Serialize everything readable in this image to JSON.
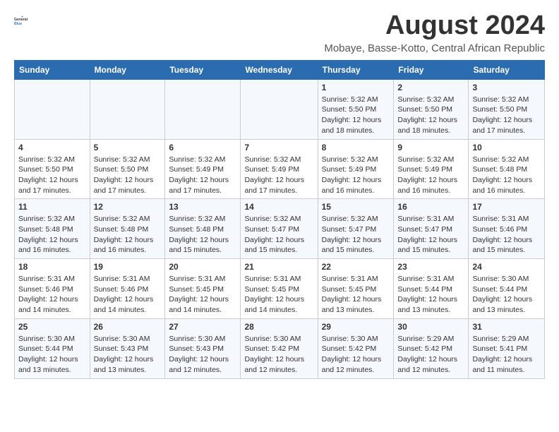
{
  "logo": {
    "line1": "General",
    "line2": "Blue"
  },
  "title": "August 2024",
  "subtitle": "Mobaye, Basse-Kotto, Central African Republic",
  "header": {
    "days": [
      "Sunday",
      "Monday",
      "Tuesday",
      "Wednesday",
      "Thursday",
      "Friday",
      "Saturday"
    ]
  },
  "weeks": [
    [
      {
        "day": "",
        "info": ""
      },
      {
        "day": "",
        "info": ""
      },
      {
        "day": "",
        "info": ""
      },
      {
        "day": "",
        "info": ""
      },
      {
        "day": "1",
        "info": "Sunrise: 5:32 AM\nSunset: 5:50 PM\nDaylight: 12 hours\nand 18 minutes."
      },
      {
        "day": "2",
        "info": "Sunrise: 5:32 AM\nSunset: 5:50 PM\nDaylight: 12 hours\nand 18 minutes."
      },
      {
        "day": "3",
        "info": "Sunrise: 5:32 AM\nSunset: 5:50 PM\nDaylight: 12 hours\nand 17 minutes."
      }
    ],
    [
      {
        "day": "4",
        "info": "Sunrise: 5:32 AM\nSunset: 5:50 PM\nDaylight: 12 hours\nand 17 minutes."
      },
      {
        "day": "5",
        "info": "Sunrise: 5:32 AM\nSunset: 5:50 PM\nDaylight: 12 hours\nand 17 minutes."
      },
      {
        "day": "6",
        "info": "Sunrise: 5:32 AM\nSunset: 5:49 PM\nDaylight: 12 hours\nand 17 minutes."
      },
      {
        "day": "7",
        "info": "Sunrise: 5:32 AM\nSunset: 5:49 PM\nDaylight: 12 hours\nand 17 minutes."
      },
      {
        "day": "8",
        "info": "Sunrise: 5:32 AM\nSunset: 5:49 PM\nDaylight: 12 hours\nand 16 minutes."
      },
      {
        "day": "9",
        "info": "Sunrise: 5:32 AM\nSunset: 5:49 PM\nDaylight: 12 hours\nand 16 minutes."
      },
      {
        "day": "10",
        "info": "Sunrise: 5:32 AM\nSunset: 5:48 PM\nDaylight: 12 hours\nand 16 minutes."
      }
    ],
    [
      {
        "day": "11",
        "info": "Sunrise: 5:32 AM\nSunset: 5:48 PM\nDaylight: 12 hours\nand 16 minutes."
      },
      {
        "day": "12",
        "info": "Sunrise: 5:32 AM\nSunset: 5:48 PM\nDaylight: 12 hours\nand 16 minutes."
      },
      {
        "day": "13",
        "info": "Sunrise: 5:32 AM\nSunset: 5:48 PM\nDaylight: 12 hours\nand 15 minutes."
      },
      {
        "day": "14",
        "info": "Sunrise: 5:32 AM\nSunset: 5:47 PM\nDaylight: 12 hours\nand 15 minutes."
      },
      {
        "day": "15",
        "info": "Sunrise: 5:32 AM\nSunset: 5:47 PM\nDaylight: 12 hours\nand 15 minutes."
      },
      {
        "day": "16",
        "info": "Sunrise: 5:31 AM\nSunset: 5:47 PM\nDaylight: 12 hours\nand 15 minutes."
      },
      {
        "day": "17",
        "info": "Sunrise: 5:31 AM\nSunset: 5:46 PM\nDaylight: 12 hours\nand 15 minutes."
      }
    ],
    [
      {
        "day": "18",
        "info": "Sunrise: 5:31 AM\nSunset: 5:46 PM\nDaylight: 12 hours\nand 14 minutes."
      },
      {
        "day": "19",
        "info": "Sunrise: 5:31 AM\nSunset: 5:46 PM\nDaylight: 12 hours\nand 14 minutes."
      },
      {
        "day": "20",
        "info": "Sunrise: 5:31 AM\nSunset: 5:45 PM\nDaylight: 12 hours\nand 14 minutes."
      },
      {
        "day": "21",
        "info": "Sunrise: 5:31 AM\nSunset: 5:45 PM\nDaylight: 12 hours\nand 14 minutes."
      },
      {
        "day": "22",
        "info": "Sunrise: 5:31 AM\nSunset: 5:45 PM\nDaylight: 12 hours\nand 13 minutes."
      },
      {
        "day": "23",
        "info": "Sunrise: 5:31 AM\nSunset: 5:44 PM\nDaylight: 12 hours\nand 13 minutes."
      },
      {
        "day": "24",
        "info": "Sunrise: 5:30 AM\nSunset: 5:44 PM\nDaylight: 12 hours\nand 13 minutes."
      }
    ],
    [
      {
        "day": "25",
        "info": "Sunrise: 5:30 AM\nSunset: 5:44 PM\nDaylight: 12 hours\nand 13 minutes."
      },
      {
        "day": "26",
        "info": "Sunrise: 5:30 AM\nSunset: 5:43 PM\nDaylight: 12 hours\nand 13 minutes."
      },
      {
        "day": "27",
        "info": "Sunrise: 5:30 AM\nSunset: 5:43 PM\nDaylight: 12 hours\nand 12 minutes."
      },
      {
        "day": "28",
        "info": "Sunrise: 5:30 AM\nSunset: 5:42 PM\nDaylight: 12 hours\nand 12 minutes."
      },
      {
        "day": "29",
        "info": "Sunrise: 5:30 AM\nSunset: 5:42 PM\nDaylight: 12 hours\nand 12 minutes."
      },
      {
        "day": "30",
        "info": "Sunrise: 5:29 AM\nSunset: 5:42 PM\nDaylight: 12 hours\nand 12 minutes."
      },
      {
        "day": "31",
        "info": "Sunrise: 5:29 AM\nSunset: 5:41 PM\nDaylight: 12 hours\nand 11 minutes."
      }
    ]
  ]
}
